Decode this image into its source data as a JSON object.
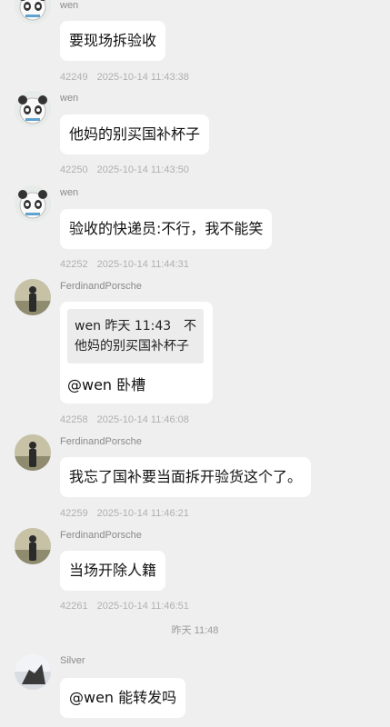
{
  "messages": [
    {
      "sender": "wen",
      "text": "要现场拆验收",
      "msg_id": "42249",
      "time": "2025-10-14 11:43:38"
    },
    {
      "sender": "wen",
      "text": "他妈的别买国补杯子",
      "msg_id": "42250",
      "time": "2025-10-14 11:43:50"
    },
    {
      "sender": "wen",
      "text": "验收的快递员:不行，我不能笑",
      "msg_id": "42252",
      "time": "2025-10-14 11:44:31"
    },
    {
      "sender": "FerdinandPorsche",
      "quote": {
        "author_time": "wen 昨天 11:43",
        "trail": "不",
        "text": "他妈的别买国补杯子"
      },
      "text": "@wen 卧槽",
      "msg_id": "42258",
      "time": "2025-10-14 11:46:08"
    },
    {
      "sender": "FerdinandPorsche",
      "text": "我忘了国补要当面拆开验货这个了。",
      "msg_id": "42259",
      "time": "2025-10-14 11:46:21"
    },
    {
      "sender": "FerdinandPorsche",
      "text": "当场开除人籍",
      "msg_id": "42261",
      "time": "2025-10-14 11:46:51"
    },
    {
      "sender": "Silver",
      "text": "@wen 能转发吗"
    }
  ],
  "separator_time": "昨天 11:48",
  "avatars": {
    "wen": "panda-avatar-icon",
    "FerdinandPorsche": "person-photo-avatar",
    "Silver": "silhouette-photo-avatar"
  },
  "colors": {
    "background": "#efefef",
    "bubble": "#ffffff",
    "quote_bg": "#ececec",
    "meta": "#b0b0b0"
  }
}
